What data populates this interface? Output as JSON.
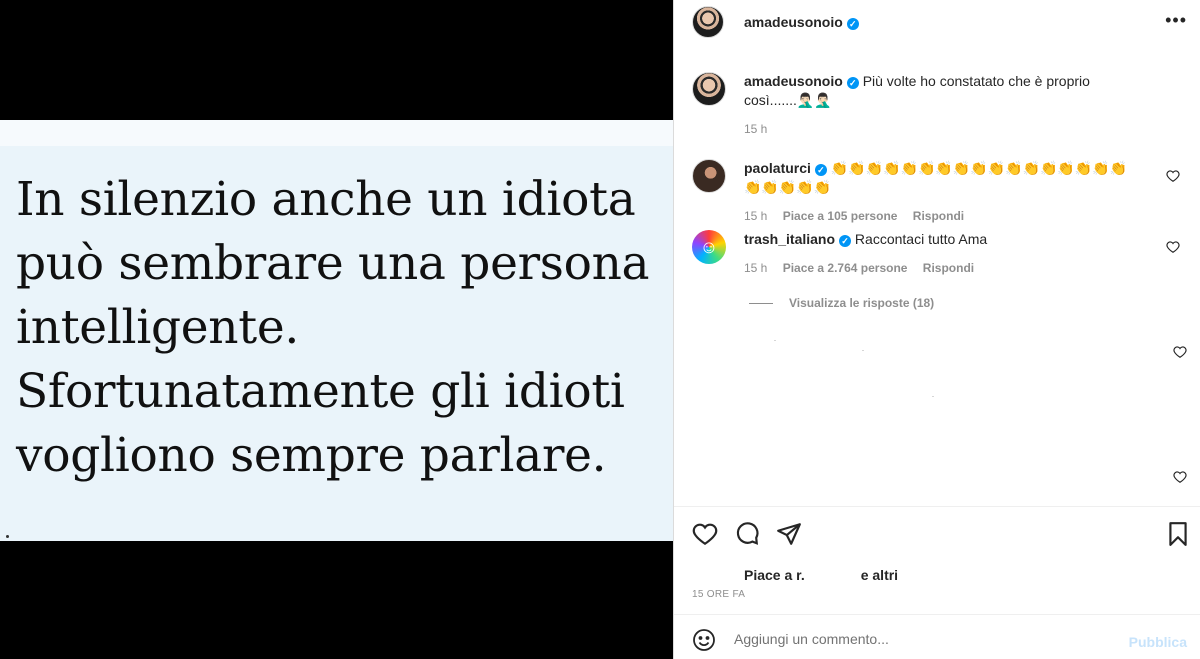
{
  "media": {
    "quote_lines": [
      "In silenzio anche un idiota",
      "può sembrare una persona",
      "intelligente.",
      "Sfortunatamente gli idioti",
      "vogliono sempre parlare."
    ]
  },
  "header": {
    "username": "amadeusonoio",
    "more_icon": "more-horizontal-icon"
  },
  "caption": {
    "username": "amadeusonoio",
    "text": "Più volte ho constatato che è proprio così.......🤦🏻‍♂️🤦🏻‍♂️",
    "time": "15 h"
  },
  "comments": [
    {
      "username": "paolaturci",
      "text": "👏👏👏👏👏👏👏👏👏👏👏👏👏👏👏👏👏👏👏👏👏👏",
      "time": "15 h",
      "likes": "Piace a 105 persone",
      "reply": "Rispondi"
    },
    {
      "username": "trash_italiano",
      "text": "Raccontaci tutto Ama",
      "time": "15 h",
      "likes": "Piace a 2.764 persone",
      "reply": "Rispondi"
    }
  ],
  "view_replies": "Visualizza le risposte (18)",
  "actions": {
    "likes_prefix": "Piace a r.",
    "likes_suffix": "e altri",
    "timestamp": "15 ORE FA"
  },
  "add_comment": {
    "placeholder": "Aggiungi un commento...",
    "post_label": "Pubblica"
  },
  "colors": {
    "verified": "#0095f6",
    "post_disabled": "#c7e3fb",
    "muted": "#8e8e8e"
  }
}
